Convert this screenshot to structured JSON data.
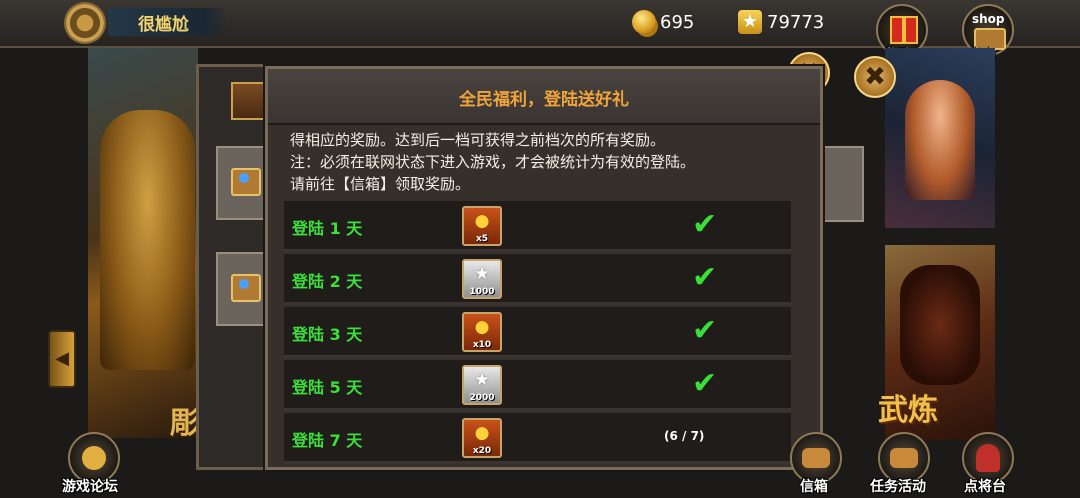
{
  "topbar": {
    "player_name": "很尴尬",
    "coins": "695",
    "stars": "79773",
    "reward_label": "奖励",
    "shop_badge": "shop",
    "shop_label": "商店"
  },
  "background": {
    "left_banner_char": "彫",
    "right_banner_text": "武炼"
  },
  "modal": {
    "title": "全民福利，登陆送好礼",
    "description": [
      "得相应的奖励。达到后一档可获得之前档次的所有奖励。",
      "注：必须在联网状态下进入游戏，才会被统计为有效的登陆。",
      "请前往【信箱】领取奖励。"
    ],
    "rows": [
      {
        "label": "登陆 1 天",
        "reward_type": "coin-stack-icon",
        "reward_qty": "x5",
        "status": "✔"
      },
      {
        "label": "登陆 2 天",
        "reward_type": "star-icon",
        "reward_qty": "1000",
        "status": "✔"
      },
      {
        "label": "登陆 3 天",
        "reward_type": "coin-stack-icon",
        "reward_qty": "x10",
        "status": "✔"
      },
      {
        "label": "登陆 5 天",
        "reward_type": "star-icon",
        "reward_qty": "2000",
        "status": "✔"
      },
      {
        "label": "登陆 7 天",
        "reward_type": "coin-stack-icon",
        "reward_qty": "x20",
        "status": "(6 / 7)"
      }
    ]
  },
  "close_glyph": "✖",
  "bottom": {
    "forum_label": "游戏论坛",
    "mailbox_label": "信箱",
    "missions_label": "任务活动",
    "generals_label": "点将台"
  },
  "colors": {
    "title_orange": "#f0a43a",
    "day_green": "#3be03b",
    "check_green": "#38e038",
    "name_gold": "#f3d36a"
  }
}
